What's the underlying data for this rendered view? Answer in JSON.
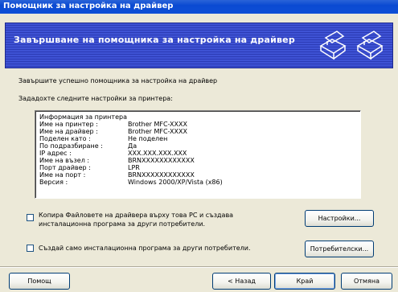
{
  "window": {
    "title": "Помощник за настройка на драйвер"
  },
  "banner": {
    "title": "Завършване на помощника за настройка на драйвер",
    "icons": [
      "printer-icon",
      "printer-icon"
    ]
  },
  "content": {
    "instruction": "Завършите успешно помощника за настройка на драйвер",
    "subtitle": "Зададохте следните настройки за принтера:",
    "info_header": "Информация за принтера",
    "info_rows": [
      {
        "label": "Име на принтер :",
        "value": "Brother MFC-XXXX"
      },
      {
        "label": "Име на драйвер :",
        "value": "Brother MFC-XXXX"
      },
      {
        "label": "Поделен като :",
        "value": "Не поделен"
      },
      {
        "label": "По подразбиране :",
        "value": "Да"
      },
      {
        "label": "IP адрес :",
        "value": "XXX.XXX.XXX.XXX"
      },
      {
        "label": "Име на възел :",
        "value": "BRNXXXXXXXXXXXX"
      },
      {
        "label": "Порт драйвер :",
        "value": "LPR"
      },
      {
        "label": "Име на порт :",
        "value": "BRNXXXXXXXXXXXX"
      },
      {
        "label": "Версия :",
        "value": "Windows 2000/XP/Vista (x86)"
      }
    ]
  },
  "options": {
    "copy_files_line1": "Копира Файловете на драйвера върху това PC и създава",
    "copy_files_line2": "инсталационна програма за други потребители.",
    "copy_files_checked": false,
    "installer_only": "Създай само инсталационна програма за други потребители.",
    "installer_only_checked": false,
    "settings_button": "Настройки...",
    "custom_button": "Потребителски..."
  },
  "footer": {
    "help_button": "Помощ",
    "back_button": "< Назад",
    "finish_button": "Край",
    "cancel_button": "Отмяна"
  },
  "colors": {
    "titlebar": "#0a4ad2",
    "banner": "#3b4cc7",
    "dialog_bg": "#ece9d8"
  }
}
